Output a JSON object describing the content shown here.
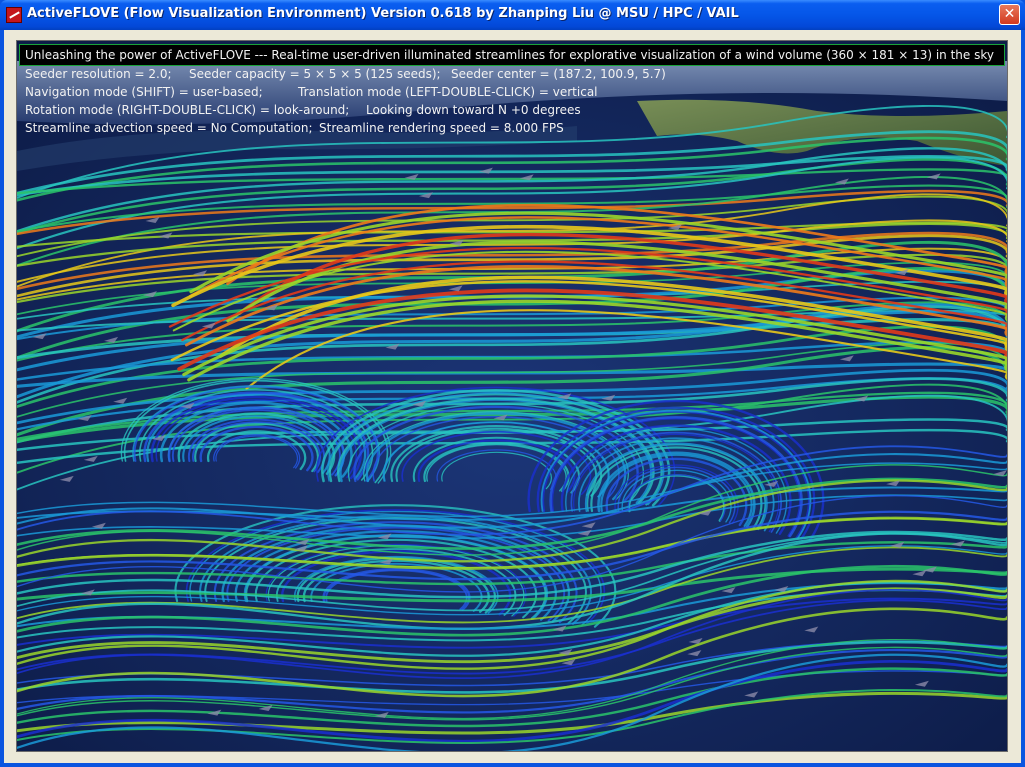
{
  "window": {
    "title": "ActiveFLOVE (Flow Visualization Environment) Version 0.618 by Zhanping Liu @ MSU / HPC / VAIL",
    "close_label": "✕"
  },
  "overlay": {
    "headline": "Unleashing the power of ActiveFLOVE --- Real-time user-driven illuminated streamlines for explorative visualization of a wind volume (360 × 181 × 13) in the sky",
    "rows": [
      [
        "Seeder resolution = 2.0;",
        "Seeder capacity = 5 × 5 × 5 (125 seeds);",
        "Seeder center = (187.2, 100.9,   5.7)"
      ],
      [
        "Navigation mode (SHIFT) = user-based;",
        "Translation mode (LEFT-DOUBLE-CLICK) = vertical"
      ],
      [
        "Rotation mode (RIGHT-DOUBLE-CLICK) = look-around;",
        "Looking down toward N +0 degrees"
      ],
      [
        "Streamline advection speed = No Computation;",
        "Streamline rendering speed =   8.000 FPS"
      ]
    ]
  },
  "colors": {
    "titlebar": "#0556e8",
    "frame": "#ece9d8",
    "ocean": "#12245a",
    "land": "#5f7640",
    "stream_palette": [
      "#1a2fd0",
      "#2458e6",
      "#1a9ad8",
      "#28c4c0",
      "#2ac46a",
      "#9ad62a",
      "#e8c81a",
      "#f07a1a",
      "#e23a1a"
    ]
  },
  "icons": {
    "app": "activeflove-app-icon",
    "close": "close-icon"
  }
}
